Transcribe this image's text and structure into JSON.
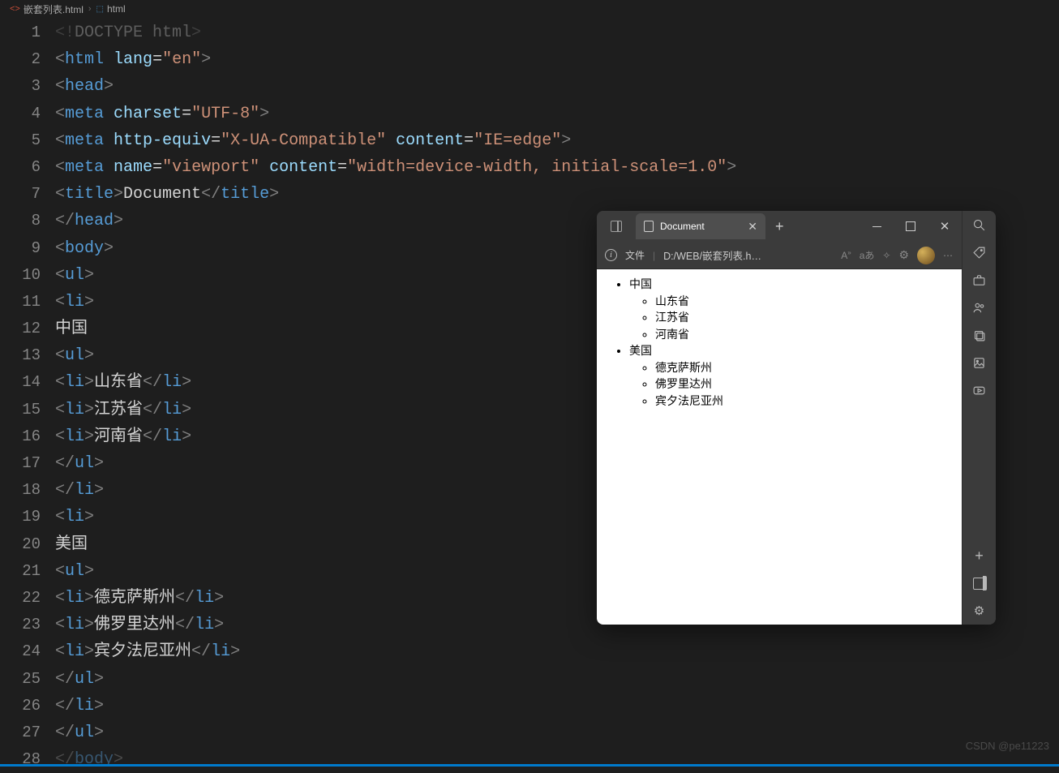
{
  "breadcrumb": {
    "file": "嵌套列表.html",
    "element": "html"
  },
  "code": {
    "lines": [
      {
        "n": 1,
        "segs": [
          [
            "tag-b",
            "<!"
          ],
          [
            "txt",
            "DOCTYPE html"
          ],
          [
            "tag-b",
            ">"
          ]
        ],
        "style": "opacity:.35"
      },
      {
        "n": 2,
        "segs": [
          [
            "tag-b",
            "<"
          ],
          [
            "tag-n",
            "html"
          ],
          [
            "txt",
            " "
          ],
          [
            "attr",
            "lang"
          ],
          [
            "eq",
            "="
          ],
          [
            "str",
            "\"en\""
          ],
          [
            "tag-b",
            ">"
          ]
        ]
      },
      {
        "n": 3,
        "segs": [
          [
            "tag-b",
            "<"
          ],
          [
            "tag-n",
            "head"
          ],
          [
            "tag-b",
            ">"
          ]
        ]
      },
      {
        "n": 4,
        "indent": 1,
        "segs": [
          [
            "tag-b",
            "<"
          ],
          [
            "tag-n",
            "meta"
          ],
          [
            "txt",
            " "
          ],
          [
            "attr",
            "charset"
          ],
          [
            "eq",
            "="
          ],
          [
            "str",
            "\"UTF-8\""
          ],
          [
            "tag-b",
            ">"
          ]
        ]
      },
      {
        "n": 5,
        "indent": 1,
        "segs": [
          [
            "tag-b",
            "<"
          ],
          [
            "tag-n",
            "meta"
          ],
          [
            "txt",
            " "
          ],
          [
            "attr",
            "http-equiv"
          ],
          [
            "eq",
            "="
          ],
          [
            "str",
            "\"X-UA-Compatible\""
          ],
          [
            "txt",
            " "
          ],
          [
            "attr",
            "content"
          ],
          [
            "eq",
            "="
          ],
          [
            "str",
            "\"IE=edge\""
          ],
          [
            "tag-b",
            ">"
          ]
        ]
      },
      {
        "n": 6,
        "indent": 1,
        "segs": [
          [
            "tag-b",
            "<"
          ],
          [
            "tag-n",
            "meta"
          ],
          [
            "txt",
            " "
          ],
          [
            "attr",
            "name"
          ],
          [
            "eq",
            "="
          ],
          [
            "str",
            "\"viewport\""
          ],
          [
            "txt",
            " "
          ],
          [
            "attr",
            "content"
          ],
          [
            "eq",
            "="
          ],
          [
            "str",
            "\"width=device-width, initial-scale=1.0\""
          ],
          [
            "tag-b",
            ">"
          ]
        ]
      },
      {
        "n": 7,
        "indent": 1,
        "segs": [
          [
            "tag-b",
            "<"
          ],
          [
            "tag-n",
            "title"
          ],
          [
            "tag-b",
            ">"
          ],
          [
            "txt",
            "Document"
          ],
          [
            "tag-b",
            "</"
          ],
          [
            "tag-n",
            "title"
          ],
          [
            "tag-b",
            ">"
          ]
        ]
      },
      {
        "n": 8,
        "segs": [
          [
            "tag-b",
            "</"
          ],
          [
            "tag-n",
            "head"
          ],
          [
            "tag-b",
            ">"
          ]
        ]
      },
      {
        "n": 9,
        "segs": [
          [
            "tag-b",
            "<"
          ],
          [
            "tag-n",
            "body"
          ],
          [
            "tag-b",
            ">"
          ]
        ]
      },
      {
        "n": 10,
        "indent": 1,
        "segs": [
          [
            "tag-b",
            "<"
          ],
          [
            "tag-n",
            "ul"
          ],
          [
            "tag-b",
            ">"
          ]
        ]
      },
      {
        "n": 11,
        "indent": 2,
        "segs": [
          [
            "tag-b",
            "<"
          ],
          [
            "tag-n",
            "li"
          ],
          [
            "tag-b",
            ">"
          ]
        ]
      },
      {
        "n": 12,
        "indent": 3,
        "segs": [
          [
            "txt",
            "中国"
          ]
        ]
      },
      {
        "n": 13,
        "indent": 3,
        "segs": [
          [
            "tag-b",
            "<"
          ],
          [
            "tag-n",
            "ul"
          ],
          [
            "tag-b",
            ">"
          ]
        ]
      },
      {
        "n": 14,
        "indent": 4,
        "segs": [
          [
            "tag-b",
            "<"
          ],
          [
            "tag-n",
            "li"
          ],
          [
            "tag-b",
            ">"
          ],
          [
            "txt",
            "山东省"
          ],
          [
            "tag-b",
            "</"
          ],
          [
            "tag-n",
            "li"
          ],
          [
            "tag-b",
            ">"
          ]
        ]
      },
      {
        "n": 15,
        "indent": 4,
        "segs": [
          [
            "tag-b",
            "<"
          ],
          [
            "tag-n",
            "li"
          ],
          [
            "tag-b",
            ">"
          ],
          [
            "txt",
            "江苏省"
          ],
          [
            "tag-b",
            "</"
          ],
          [
            "tag-n",
            "li"
          ],
          [
            "tag-b",
            ">"
          ]
        ]
      },
      {
        "n": 16,
        "indent": 4,
        "segs": [
          [
            "tag-b",
            "<"
          ],
          [
            "tag-n",
            "li"
          ],
          [
            "tag-b",
            ">"
          ],
          [
            "txt",
            "河南省"
          ],
          [
            "tag-b",
            "</"
          ],
          [
            "tag-n",
            "li"
          ],
          [
            "tag-b",
            ">"
          ]
        ]
      },
      {
        "n": 17,
        "indent": 3,
        "segs": [
          [
            "tag-b",
            "</"
          ],
          [
            "tag-n",
            "ul"
          ],
          [
            "tag-b",
            ">"
          ]
        ]
      },
      {
        "n": 18,
        "indent": 2,
        "segs": [
          [
            "tag-b",
            "</"
          ],
          [
            "tag-n",
            "li"
          ],
          [
            "tag-b",
            ">"
          ]
        ]
      },
      {
        "n": 19,
        "indent": 2,
        "segs": [
          [
            "tag-b",
            "<"
          ],
          [
            "tag-n",
            "li"
          ],
          [
            "tag-b",
            ">"
          ]
        ]
      },
      {
        "n": 20,
        "indent": 3,
        "segs": [
          [
            "txt",
            "美国"
          ]
        ]
      },
      {
        "n": 21,
        "indent": 3,
        "segs": [
          [
            "tag-b",
            "<"
          ],
          [
            "tag-n",
            "ul"
          ],
          [
            "tag-b",
            ">"
          ]
        ]
      },
      {
        "n": 22,
        "indent": 4,
        "segs": [
          [
            "tag-b",
            "<"
          ],
          [
            "tag-n",
            "li"
          ],
          [
            "tag-b",
            ">"
          ],
          [
            "txt",
            "德克萨斯州"
          ],
          [
            "tag-b",
            "</"
          ],
          [
            "tag-n",
            "li"
          ],
          [
            "tag-b",
            ">"
          ]
        ]
      },
      {
        "n": 23,
        "indent": 4,
        "segs": [
          [
            "tag-b",
            "<"
          ],
          [
            "tag-n",
            "li"
          ],
          [
            "tag-b",
            ">"
          ],
          [
            "txt",
            "佛罗里达州"
          ],
          [
            "tag-b",
            "</"
          ],
          [
            "tag-n",
            "li"
          ],
          [
            "tag-b",
            ">"
          ]
        ]
      },
      {
        "n": 24,
        "indent": 4,
        "segs": [
          [
            "tag-b",
            "<"
          ],
          [
            "tag-n",
            "li"
          ],
          [
            "tag-b",
            ">"
          ],
          [
            "txt",
            "宾夕法尼亚州"
          ],
          [
            "tag-b",
            "</"
          ],
          [
            "tag-n",
            "li"
          ],
          [
            "tag-b",
            ">"
          ]
        ]
      },
      {
        "n": 25,
        "indent": 3,
        "segs": [
          [
            "tag-b",
            "</"
          ],
          [
            "tag-n",
            "ul"
          ],
          [
            "tag-b",
            ">"
          ]
        ]
      },
      {
        "n": 26,
        "indent": 2,
        "segs": [
          [
            "tag-b",
            "</"
          ],
          [
            "tag-n",
            "li"
          ],
          [
            "tag-b",
            ">"
          ]
        ]
      },
      {
        "n": 27,
        "indent": 1,
        "segs": [
          [
            "tag-b",
            "</"
          ],
          [
            "tag-n",
            "ul"
          ],
          [
            "tag-b",
            ">"
          ]
        ]
      },
      {
        "n": 28,
        "segs": [
          [
            "tag-b",
            "</"
          ],
          [
            "tag-n",
            "body"
          ],
          [
            "tag-b",
            ">"
          ]
        ],
        "style": "opacity:.45"
      }
    ]
  },
  "browser": {
    "tabTitle": "Document",
    "addrLabel": "文件",
    "addrPath": "D:/WEB/嵌套列表.h…",
    "list": [
      {
        "label": "中国",
        "children": [
          "山东省",
          "江苏省",
          "河南省"
        ]
      },
      {
        "label": "美国",
        "children": [
          "德克萨斯州",
          "佛罗里达州",
          "宾夕法尼亚州"
        ]
      }
    ]
  },
  "watermark": "CSDN @pe11223"
}
